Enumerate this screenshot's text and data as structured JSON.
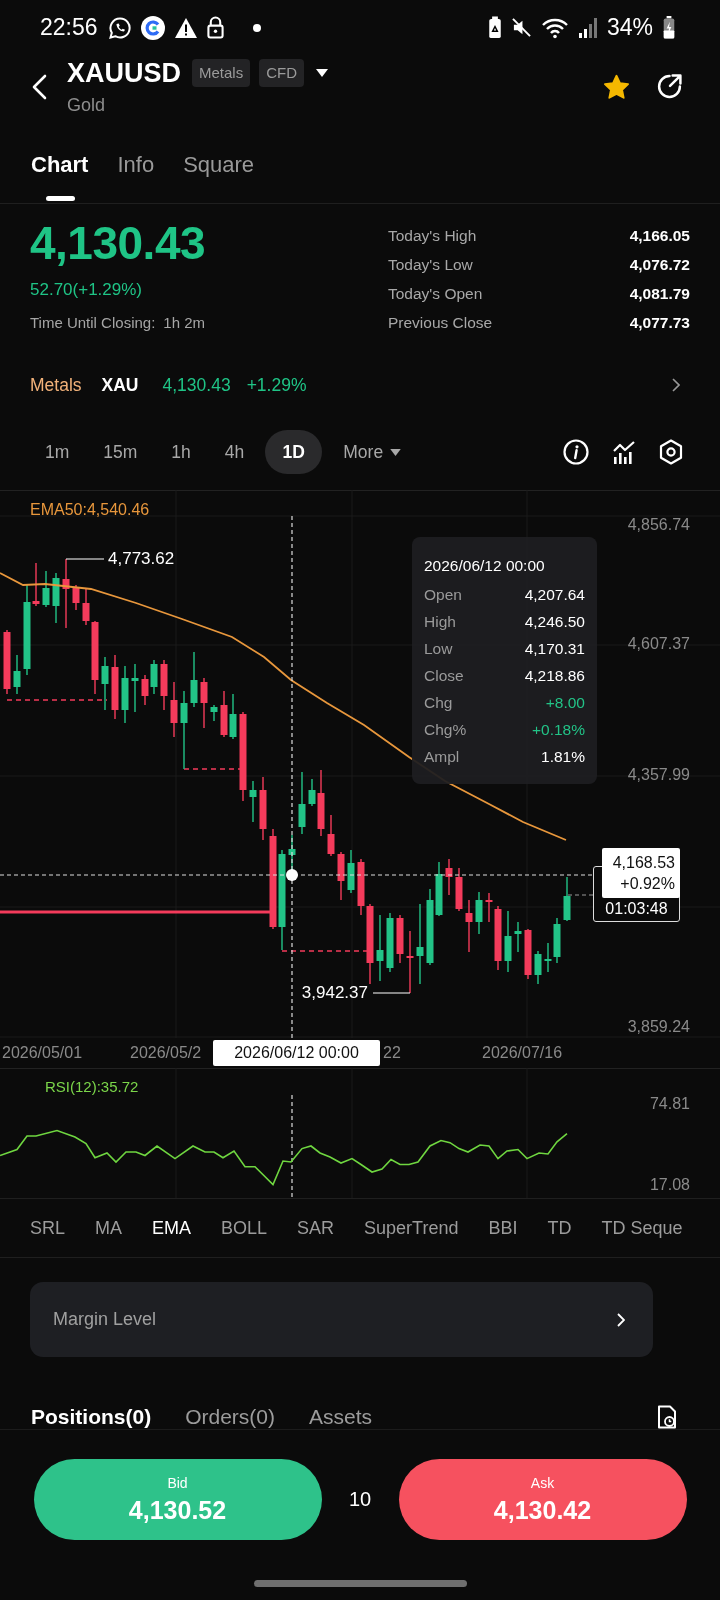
{
  "status_bar": {
    "time": "22:56",
    "battery": "34%"
  },
  "header": {
    "symbol": "XAUUSD",
    "tags": [
      "Metals",
      "CFD"
    ],
    "name": "Gold",
    "favorited": true
  },
  "tabs": [
    {
      "label": "Chart",
      "selected": true
    },
    {
      "label": "Info",
      "selected": false
    },
    {
      "label": "Square",
      "selected": false
    }
  ],
  "quote": {
    "price": "4,130.43",
    "change": "52.70(+1.29%)",
    "closing_label": "Time Until Closing:",
    "closing_value": "1h 2m",
    "stats": [
      {
        "label": "Today's High",
        "value": "4,166.05"
      },
      {
        "label": "Today's Low",
        "value": "4,076.72"
      },
      {
        "label": "Today's Open",
        "value": "4,081.79"
      },
      {
        "label": "Previous Close",
        "value": "4,077.73"
      }
    ]
  },
  "related": {
    "category": "Metals",
    "symbol": "XAU",
    "price": "4,130.43",
    "change": "+1.29%"
  },
  "intervals": [
    {
      "label": "1m",
      "selected": false
    },
    {
      "label": "15m",
      "selected": false
    },
    {
      "label": "1h",
      "selected": false
    },
    {
      "label": "4h",
      "selected": false
    },
    {
      "label": "1D",
      "selected": true
    }
  ],
  "more": "More",
  "chart": {
    "ema_label": "EMA50:4,540.46",
    "price_ticks": [
      "4,856.74",
      "4,607.37",
      "4,357.99",
      "3,859.24"
    ],
    "high_label": "4,773.62",
    "low_label": "3,942.37",
    "crosshair_price": "4,168.53",
    "crosshair_change": "+0.92%",
    "countdown": "01:03:48",
    "date_ticks": [
      "2026/05/01",
      "2026/05/2",
      "22",
      "2026/07/16"
    ],
    "crosshair_date": "2026/06/12 00:00",
    "tooltip": {
      "date": "2026/06/12 00:00",
      "rows": [
        {
          "label": "Open",
          "value": "4,207.64",
          "kind": "plain"
        },
        {
          "label": "High",
          "value": "4,246.50",
          "kind": "plain"
        },
        {
          "label": "Low",
          "value": "4,170.31",
          "kind": "plain"
        },
        {
          "label": "Close",
          "value": "4,218.86",
          "kind": "plain"
        },
        {
          "label": "Chg",
          "value": "+8.00",
          "kind": "gain"
        },
        {
          "label": "Chg%",
          "value": "+0.18%",
          "kind": "gain"
        },
        {
          "label": "Ampl",
          "value": "1.81%",
          "kind": "plain"
        }
      ]
    }
  },
  "rsi": {
    "label": "RSI(12):35.72",
    "ticks": [
      "74.81",
      "17.08"
    ]
  },
  "indicators": [
    {
      "label": "SRL",
      "selected": false
    },
    {
      "label": "MA",
      "selected": false
    },
    {
      "label": "EMA",
      "selected": true
    },
    {
      "label": "BOLL",
      "selected": false
    },
    {
      "label": "SAR",
      "selected": false
    },
    {
      "label": "SuperTrend",
      "selected": false
    },
    {
      "label": "BBI",
      "selected": false
    },
    {
      "label": "TD",
      "selected": false
    },
    {
      "label": "TD Seque",
      "selected": false
    }
  ],
  "margin_card": {
    "label": "Margin Level"
  },
  "position_tabs": [
    {
      "label": "Positions(0)",
      "selected": true
    },
    {
      "label": "Orders(0)",
      "selected": false
    },
    {
      "label": "Assets",
      "selected": false
    }
  ],
  "trade": {
    "bid_label": "Bid",
    "bid": "4,130.52",
    "spread": "10",
    "ask_label": "Ask",
    "ask": "4,130.42"
  }
}
